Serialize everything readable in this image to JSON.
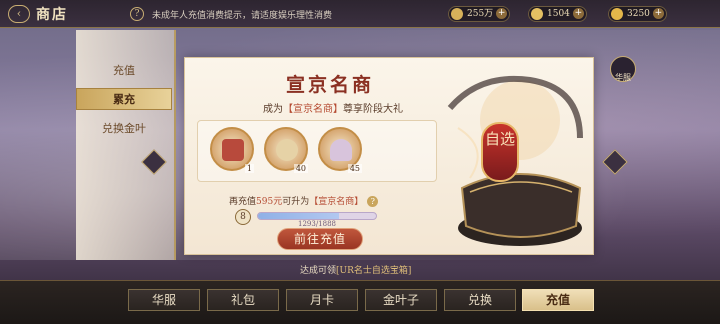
{
  "header": {
    "title": "商店",
    "notice": "未成年人充值消费提示，请适度娱乐理性消费",
    "back_icon": "back-arrow-icon",
    "help_icon": "question-icon"
  },
  "currencies": [
    {
      "name": "coin",
      "value": "255万",
      "color": "#d6b15a"
    },
    {
      "name": "leaf",
      "value": "1504",
      "color": "#e4c063"
    },
    {
      "name": "ingot",
      "value": "3250",
      "color": "#e3b64a"
    }
  ],
  "side_tabs": [
    {
      "label": "充值",
      "active": false
    },
    {
      "label": "累充",
      "active": true
    },
    {
      "label": "兑换金叶",
      "active": false
    }
  ],
  "card": {
    "title": "宣京名商",
    "subtitle_prefix": "成为",
    "subtitle_highlight": "【宣京名商】",
    "subtitle_suffix": "尊享阶段大礼",
    "rewards": [
      {
        "count": "1",
        "icon": "cosmetic-box-icon",
        "color": "#b84a3c"
      },
      {
        "count": "40",
        "icon": "seal-icon",
        "color": "#e6d2a6"
      },
      {
        "count": "45",
        "icon": "shell-icon",
        "color": "#d8c4dc"
      }
    ],
    "upgrade_prefix": "再充值",
    "upgrade_amount": "595元",
    "upgrade_mid": "可升为",
    "upgrade_target": "【宣京名商】",
    "level": "8",
    "progress_text": "1293/1888",
    "progress_fraction": 0.685,
    "button_label": "前往充值",
    "chest_label": "自选"
  },
  "gift": {
    "label": "华服",
    "icon": "gift-icon"
  },
  "hint": {
    "prefix": "达成可领",
    "highlight": "[UR名士自选宝箱]"
  },
  "bottom_tabs": [
    {
      "label": "华服",
      "active": false
    },
    {
      "label": "礼包",
      "active": false
    },
    {
      "label": "月卡",
      "active": false
    },
    {
      "label": "金叶子",
      "active": false
    },
    {
      "label": "兑换",
      "active": false
    },
    {
      "label": "充值",
      "active": true
    }
  ]
}
